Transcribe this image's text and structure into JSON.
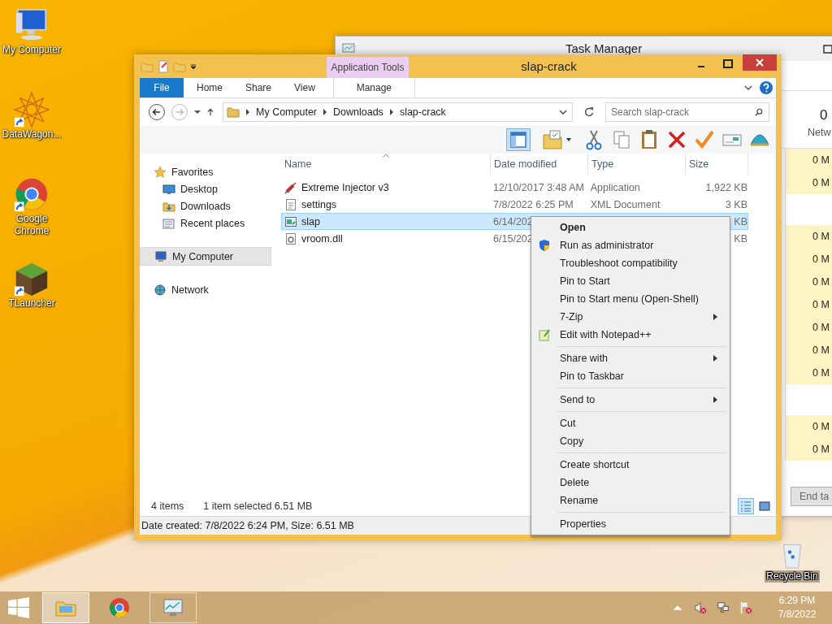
{
  "desktop_icons": [
    {
      "label": "My Computer",
      "kind": "computer",
      "shortcut": false
    },
    {
      "label": "DataWagon...",
      "kind": "mandala",
      "shortcut": true
    },
    {
      "label": "Google Chrome",
      "kind": "chrome",
      "shortcut": true
    },
    {
      "label": "TLauncher",
      "kind": "block",
      "shortcut": true
    }
  ],
  "recycle_bin": {
    "label": "Recycle Bin"
  },
  "task_manager": {
    "title": "Task Manager",
    "column_value": "0",
    "column_label": "Netw",
    "rows": [
      {
        "kind": "process",
        "value": "0 M"
      },
      {
        "kind": "process",
        "value": "0 M"
      },
      {
        "kind": "group"
      },
      {
        "kind": "process",
        "value": "0 M"
      },
      {
        "kind": "process",
        "value": "0 M"
      },
      {
        "kind": "process",
        "value": "0 M"
      },
      {
        "kind": "process",
        "value": "0 M"
      },
      {
        "kind": "process",
        "value": "0 M"
      },
      {
        "kind": "process",
        "value": "0 M"
      },
      {
        "kind": "process",
        "value": "0 M"
      },
      {
        "kind": "group"
      },
      {
        "kind": "process",
        "value": "0 M"
      },
      {
        "kind": "process",
        "value": "0 M"
      }
    ],
    "button": "End ta"
  },
  "explorer": {
    "title": "slap-crack",
    "context_tab": "Application Tools",
    "ribbon_tabs": [
      {
        "label": "File",
        "kind": "file"
      },
      {
        "label": "Home",
        "kind": "tab"
      },
      {
        "label": "Share",
        "kind": "tab"
      },
      {
        "label": "View",
        "kind": "tab"
      },
      {
        "label": "Manage",
        "kind": "contextual"
      }
    ],
    "address": [
      "My Computer",
      "Downloads",
      "slap-crack"
    ],
    "search": {
      "placeholder": "Search slap-crack"
    },
    "nav": [
      {
        "label": "Favorites",
        "kind": "favorites",
        "selected": false,
        "children": [
          {
            "label": "Desktop",
            "kind": "desktop",
            "selected": false
          },
          {
            "label": "Downloads",
            "kind": "downloads",
            "selected": false
          },
          {
            "label": "Recent places",
            "kind": "recent",
            "selected": false
          }
        ]
      },
      {
        "label": "My Computer",
        "kind": "computer",
        "selected": true
      },
      {
        "label": "Network",
        "kind": "network",
        "selected": false
      }
    ],
    "columns": [
      {
        "label": "Name",
        "sorted": true
      },
      {
        "label": "Date modified",
        "sorted": false
      },
      {
        "label": "Type",
        "sorted": false
      },
      {
        "label": "Size",
        "sorted": false
      }
    ],
    "files": [
      {
        "name": "Extreme Injector v3",
        "date": "12/10/2017 3:48 AM",
        "type": "Application",
        "size": "1,922 KB",
        "kind": "injector",
        "selected": false
      },
      {
        "name": "settings",
        "date": "7/8/2022 6:25 PM",
        "type": "XML Document",
        "size": "3 KB",
        "kind": "xml",
        "selected": false
      },
      {
        "name": "slap",
        "date": "6/14/202",
        "size": "KB",
        "kind": "app",
        "selected": true
      },
      {
        "name": "vroom.dll",
        "date": "6/15/202",
        "size": "KB",
        "kind": "dll",
        "selected": false
      }
    ],
    "item_count": "4 items",
    "selection": "1 item selected  6.51 MB",
    "views": [
      {
        "kind": "details",
        "selected": true
      },
      {
        "kind": "large",
        "selected": false
      }
    ],
    "details": "Date created: 7/8/2022 6:24 PM, Size: 6.51 MB"
  },
  "context_menu": [
    [
      {
        "label": "Open",
        "bold": true
      },
      {
        "label": "Run as administrator",
        "kind": "admin"
      },
      {
        "label": "Troubleshoot compatibility"
      },
      {
        "label": "Pin to Start"
      },
      {
        "label": "Pin to Start menu (Open-Shell)"
      },
      {
        "label": "7-Zip",
        "submenu": true
      },
      {
        "label": "Edit with Notepad++",
        "kind": "editor"
      }
    ],
    [
      {
        "label": "Share with",
        "submenu": true
      },
      {
        "label": "Pin to Taskbar"
      }
    ],
    [
      {
        "label": "Send to",
        "submenu": true
      }
    ],
    [
      {
        "label": "Cut"
      },
      {
        "label": "Copy"
      }
    ],
    [
      {
        "label": "Create shortcut"
      },
      {
        "label": "Delete"
      },
      {
        "label": "Rename"
      }
    ],
    [
      {
        "label": "Properties"
      }
    ]
  ],
  "taskbar": {
    "apps": [
      {
        "kind": "explorer",
        "selected": true,
        "running": true
      },
      {
        "kind": "chrome",
        "selected": false,
        "running": false
      },
      {
        "kind": "monitor",
        "selected": false,
        "running": true
      }
    ],
    "time": "6:29 PM",
    "date": "7/8/2022"
  }
}
